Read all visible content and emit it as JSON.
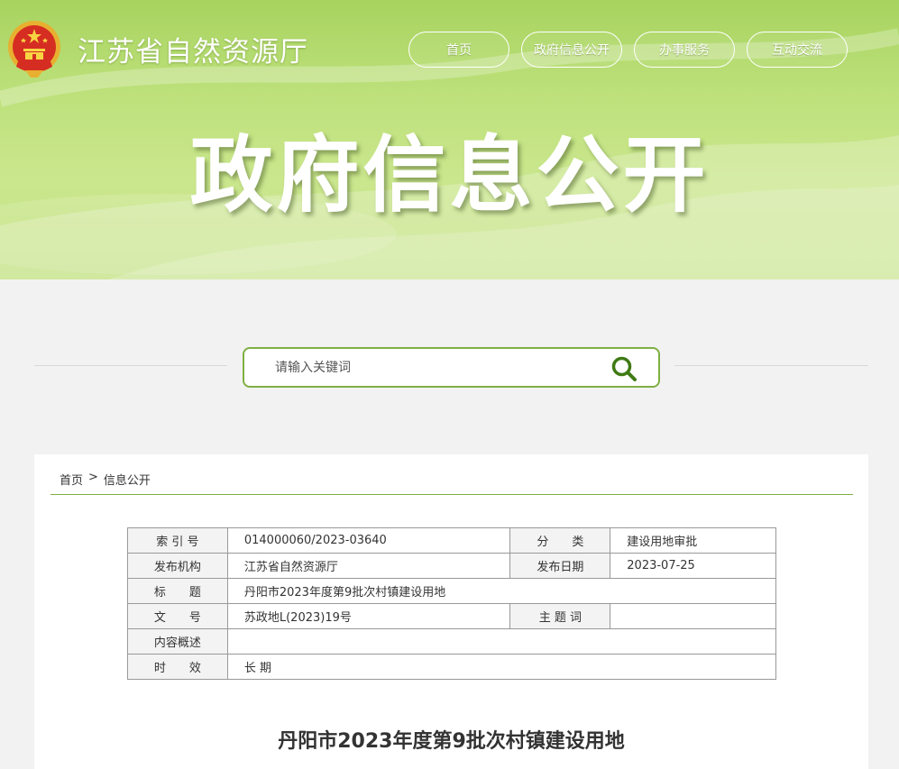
{
  "header": {
    "site_title": "江苏省自然资源厅",
    "hero_title": "政府信息公开",
    "nav": [
      "首页",
      "政府信息公开",
      "办事服务",
      "互动交流"
    ]
  },
  "search": {
    "placeholder": "请输入关键词"
  },
  "breadcrumb": {
    "home": "首页",
    "separator": ">",
    "current": "信息公开"
  },
  "meta": {
    "index_label": "索 引 号",
    "index_value": "014000060/2023-03640",
    "category_label": "分　　类",
    "category_value": "建设用地审批",
    "publisher_label": "发布机构",
    "publisher_value": "江苏省自然资源厅",
    "date_label": "发布日期",
    "date_value": "2023-07-25",
    "title_label": "标　　题",
    "title_value": "丹阳市2023年度第9批次村镇建设用地",
    "docno_label": "文　　号",
    "docno_value": "苏政地L(2023)19号",
    "keywords_label": "主 题 词",
    "keywords_value": "",
    "summary_label": "内容概述",
    "summary_value": "",
    "validity_label": "时　　效",
    "validity_value": "长 期"
  },
  "document": {
    "title": "丹阳市2023年度第9批次村镇建设用地"
  },
  "colors": {
    "banner_green": "#a7d35f",
    "accent_green": "#7eb043",
    "search_icon": "#3f7a14"
  },
  "icons": {
    "emblem": "national-emblem-icon",
    "search": "search-icon"
  }
}
